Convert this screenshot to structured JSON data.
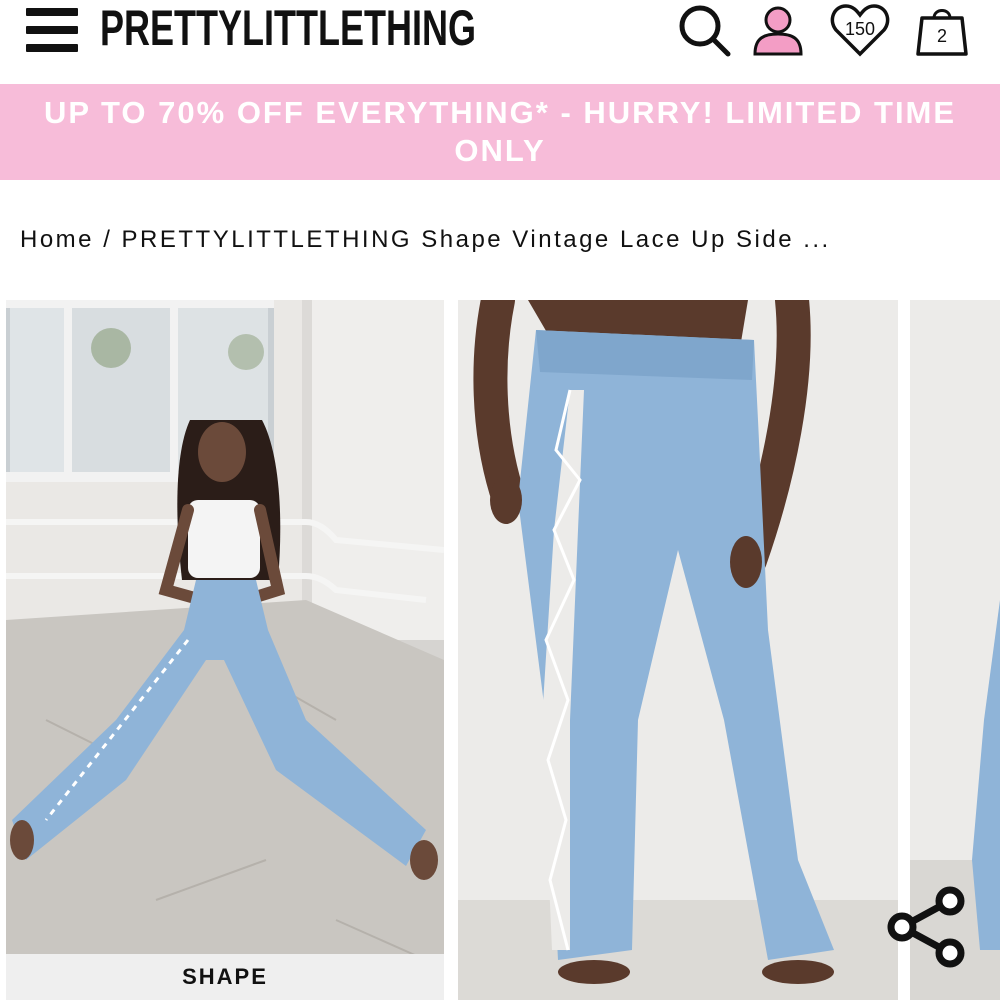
{
  "header": {
    "logo": "PRETTYLITTLETHING",
    "wishlist_count": "150",
    "bag_count": "2"
  },
  "promo": {
    "text": "UP TO 70% OFF EVERYTHING* - HURRY! LIMITED TIME ONLY"
  },
  "breadcrumb": {
    "home": "Home",
    "separator": " / ",
    "current": "PRETTYLITTLETHING Shape Vintage Lace Up Side ..."
  },
  "gallery": {
    "label": "SHAPE"
  },
  "icons": {
    "menu": "menu-icon",
    "search": "search-icon",
    "account": "user-icon",
    "wishlist": "heart-icon",
    "bag": "shopping-bag-icon",
    "share": "share-icon"
  },
  "colors": {
    "promo_background": "#f7bcd9",
    "account_icon": "#f39dc5",
    "denim": "#8fb4d8"
  }
}
